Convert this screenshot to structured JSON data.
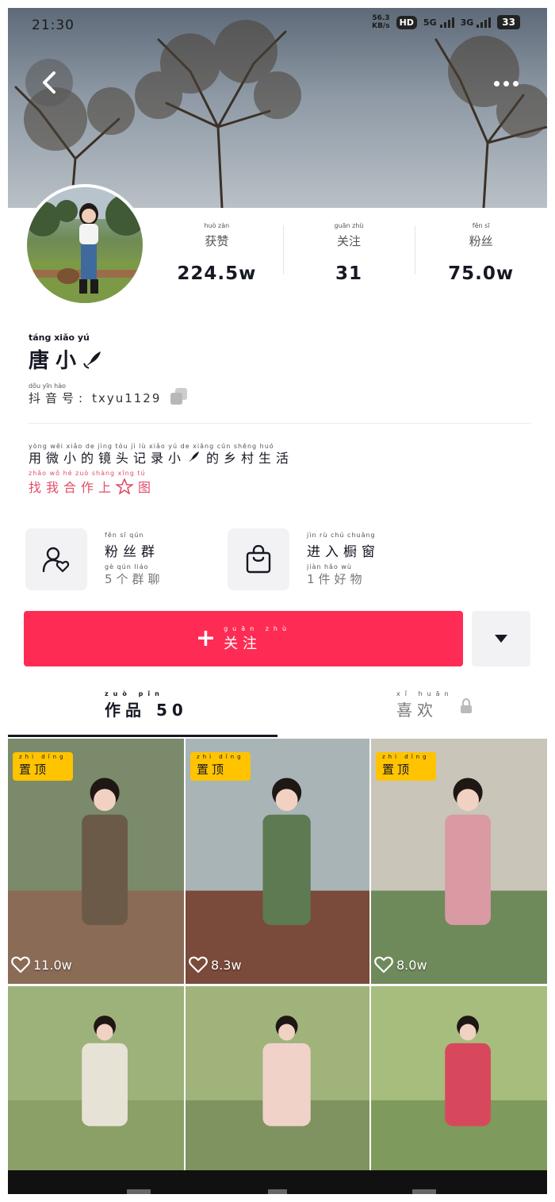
{
  "status_bar": {
    "time": "21:30",
    "net_speed_value": "56.3",
    "net_speed_unit": "KB/s",
    "hd": "HD",
    "signal_1": "5G",
    "signal_2": "3G",
    "battery": "33"
  },
  "profile": {
    "stats": [
      {
        "pinyin": "huò  zàn",
        "label": "获赞",
        "value": "224.5w"
      },
      {
        "pinyin": "guān  zhù",
        "label": "关注",
        "value": "31"
      },
      {
        "pinyin": "fěn  sī",
        "label": "粉丝",
        "value": "75.0w"
      }
    ],
    "name_pinyin": "táng   xiǎo   yú",
    "name": "唐小",
    "id_pinyin": "dǒu  yīn  hào",
    "id_label": "抖音号:",
    "id_value": "txyu1129",
    "bio_pinyin": "yòng wēi xiǎo de jìng tóu jì lù xiǎo yú de xiāng cūn shēng huó",
    "bio": "用微小的镜头记录小",
    "bio_suffix": "的乡村生活",
    "link_pinyin": "zhǎo wǒ hé zuò shàng xīng tú",
    "link": "找我合作上",
    "link_suffix": "图"
  },
  "features": [
    {
      "title_pinyin": "fěn  sī  qún",
      "title": "粉丝群",
      "sub_pinyin": "gè  qún  liáo",
      "sub": "5个群聊",
      "icon": "user-heart-icon"
    },
    {
      "title_pinyin": "jìn  rù  chú chuāng",
      "title": "进入橱窗",
      "sub_pinyin": "jiàn  hǎo  wù",
      "sub": "1件好物",
      "icon": "shopping-bag-icon"
    }
  ],
  "actions": {
    "follow_pinyin": "guān   zhù",
    "follow_label": "关注",
    "follow_color": "#fe2c55"
  },
  "tabs": {
    "works_pinyin": "zuò  pǐn",
    "works_label": "作品 50",
    "likes_pinyin": "xǐ  huān",
    "likes_label": "喜欢"
  },
  "videos": [
    {
      "pinned_pinyin": "zhì  dǐng",
      "pinned": "置顶",
      "likes": "11.0w",
      "tone": [
        "#7a8a6a",
        "#6b5a48",
        "#8a6b56"
      ]
    },
    {
      "pinned_pinyin": "zhì  dǐng",
      "pinned": "置顶",
      "likes": "8.3w",
      "tone": [
        "#a9b4b7",
        "#5d7a52",
        "#7a4a3a"
      ]
    },
    {
      "pinned_pinyin": "zhì  dǐng",
      "pinned": "置顶",
      "likes": "8.0w",
      "tone": [
        "#c9c5b9",
        "#d99aa3",
        "#6f8a5a"
      ]
    },
    {
      "tone": [
        "#9db27a",
        "#e7e2d6",
        "#8aa066"
      ]
    },
    {
      "tone": [
        "#9fb37b",
        "#f0d2c8",
        "#7e9360"
      ]
    },
    {
      "tone": [
        "#a6bd7e",
        "#d8485c",
        "#7e9a5c"
      ]
    }
  ]
}
